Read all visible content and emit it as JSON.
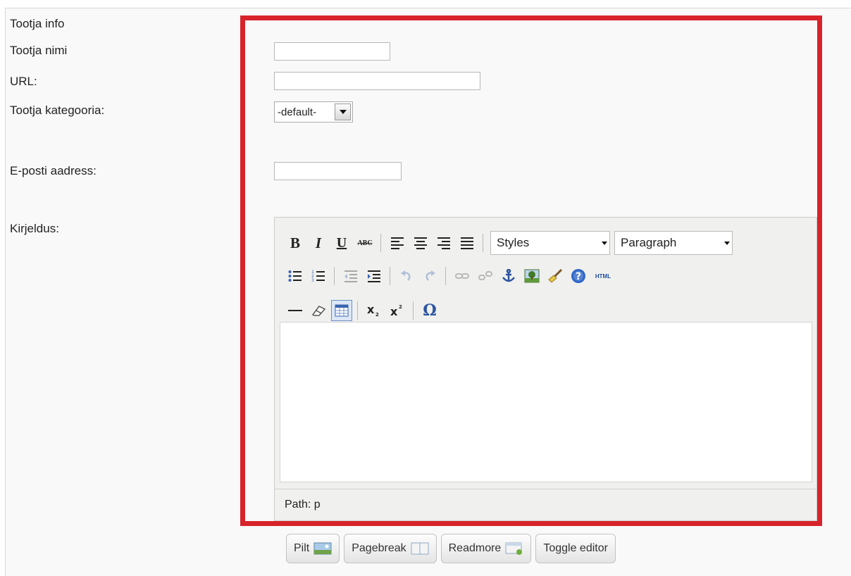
{
  "form": {
    "labels": {
      "info": "Tootja info",
      "name": "Tootja nimi",
      "url": "URL:",
      "category": "Tootja kategooria:",
      "email": "E-posti aadress:",
      "description": "Kirjeldus:"
    },
    "fields": {
      "name_value": "",
      "url_value": "",
      "email_value": "",
      "category_selected": "-default-"
    }
  },
  "editor": {
    "toolbar": {
      "bold": "B",
      "italic": "I",
      "underline": "U",
      "strike": "ABC",
      "styles": "Styles",
      "format": "Paragraph",
      "html": "HTML",
      "omega": "Ω"
    },
    "path_label": "Path: p",
    "content": ""
  },
  "buttons": {
    "pilt": "Pilt",
    "pagebreak": "Pagebreak",
    "readmore": "Readmore",
    "toggle": "Toggle editor"
  },
  "colors": {
    "highlight_border": "#d8232a",
    "active_tool": "#6a8fc7",
    "icon_blue": "#3a64b0"
  },
  "icons": [
    "bold-icon",
    "italic-icon",
    "underline-icon",
    "strikethrough-icon",
    "align-left-icon",
    "align-center-icon",
    "align-right-icon",
    "align-justify-icon",
    "bullet-list-icon",
    "numbered-list-icon",
    "outdent-icon",
    "indent-icon",
    "undo-icon",
    "redo-icon",
    "link-icon",
    "unlink-icon",
    "anchor-icon",
    "image-icon",
    "cleanup-icon",
    "help-icon",
    "html-icon",
    "horizontal-rule-icon",
    "eraser-icon",
    "table-icon",
    "subscript-icon",
    "superscript-icon",
    "special-char-icon"
  ]
}
